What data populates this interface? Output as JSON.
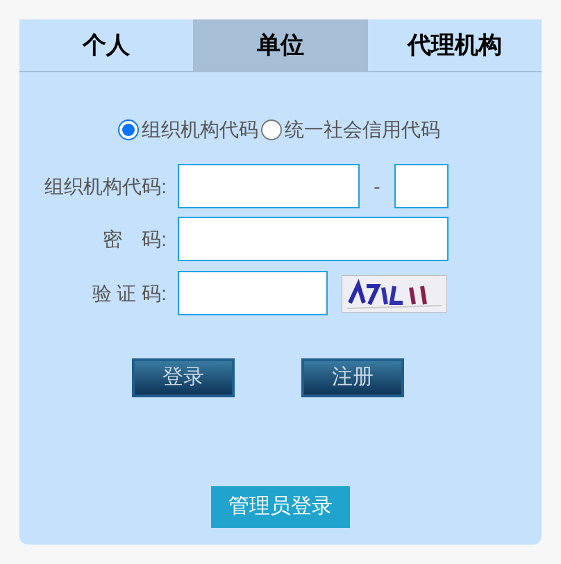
{
  "tabs": [
    {
      "label": "个人",
      "selected": false
    },
    {
      "label": "单位",
      "selected": true
    },
    {
      "label": "代理机构",
      "selected": false
    }
  ],
  "code_types": [
    {
      "label": "组织机构代码",
      "selected": true
    },
    {
      "label": "统一社会信用代码",
      "selected": false
    }
  ],
  "form": {
    "org_code_label": "组织机构代码:",
    "separator": "-",
    "password_label": "密　码:",
    "captcha_label": "验 证 码:"
  },
  "buttons": [
    {
      "label": "登录"
    },
    {
      "label": "注册"
    }
  ],
  "admin_button": "管理员登录"
}
